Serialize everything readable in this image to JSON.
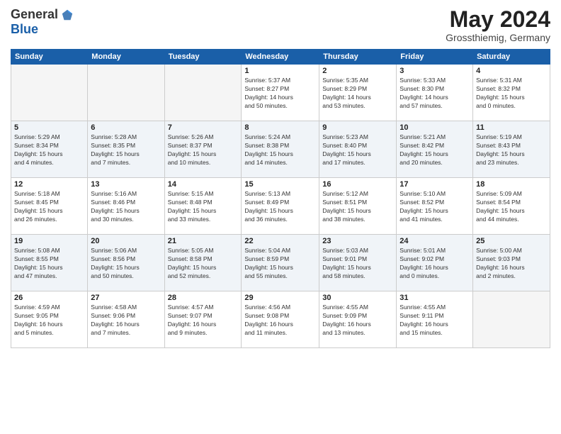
{
  "logo": {
    "general": "General",
    "blue": "Blue"
  },
  "title": "May 2024",
  "location": "Grossthiemig, Germany",
  "weekdays": [
    "Sunday",
    "Monday",
    "Tuesday",
    "Wednesday",
    "Thursday",
    "Friday",
    "Saturday"
  ],
  "weeks": [
    [
      {
        "day": "",
        "info": ""
      },
      {
        "day": "",
        "info": ""
      },
      {
        "day": "",
        "info": ""
      },
      {
        "day": "1",
        "info": "Sunrise: 5:37 AM\nSunset: 8:27 PM\nDaylight: 14 hours\nand 50 minutes."
      },
      {
        "day": "2",
        "info": "Sunrise: 5:35 AM\nSunset: 8:29 PM\nDaylight: 14 hours\nand 53 minutes."
      },
      {
        "day": "3",
        "info": "Sunrise: 5:33 AM\nSunset: 8:30 PM\nDaylight: 14 hours\nand 57 minutes."
      },
      {
        "day": "4",
        "info": "Sunrise: 5:31 AM\nSunset: 8:32 PM\nDaylight: 15 hours\nand 0 minutes."
      }
    ],
    [
      {
        "day": "5",
        "info": "Sunrise: 5:29 AM\nSunset: 8:34 PM\nDaylight: 15 hours\nand 4 minutes."
      },
      {
        "day": "6",
        "info": "Sunrise: 5:28 AM\nSunset: 8:35 PM\nDaylight: 15 hours\nand 7 minutes."
      },
      {
        "day": "7",
        "info": "Sunrise: 5:26 AM\nSunset: 8:37 PM\nDaylight: 15 hours\nand 10 minutes."
      },
      {
        "day": "8",
        "info": "Sunrise: 5:24 AM\nSunset: 8:38 PM\nDaylight: 15 hours\nand 14 minutes."
      },
      {
        "day": "9",
        "info": "Sunrise: 5:23 AM\nSunset: 8:40 PM\nDaylight: 15 hours\nand 17 minutes."
      },
      {
        "day": "10",
        "info": "Sunrise: 5:21 AM\nSunset: 8:42 PM\nDaylight: 15 hours\nand 20 minutes."
      },
      {
        "day": "11",
        "info": "Sunrise: 5:19 AM\nSunset: 8:43 PM\nDaylight: 15 hours\nand 23 minutes."
      }
    ],
    [
      {
        "day": "12",
        "info": "Sunrise: 5:18 AM\nSunset: 8:45 PM\nDaylight: 15 hours\nand 26 minutes."
      },
      {
        "day": "13",
        "info": "Sunrise: 5:16 AM\nSunset: 8:46 PM\nDaylight: 15 hours\nand 30 minutes."
      },
      {
        "day": "14",
        "info": "Sunrise: 5:15 AM\nSunset: 8:48 PM\nDaylight: 15 hours\nand 33 minutes."
      },
      {
        "day": "15",
        "info": "Sunrise: 5:13 AM\nSunset: 8:49 PM\nDaylight: 15 hours\nand 36 minutes."
      },
      {
        "day": "16",
        "info": "Sunrise: 5:12 AM\nSunset: 8:51 PM\nDaylight: 15 hours\nand 38 minutes."
      },
      {
        "day": "17",
        "info": "Sunrise: 5:10 AM\nSunset: 8:52 PM\nDaylight: 15 hours\nand 41 minutes."
      },
      {
        "day": "18",
        "info": "Sunrise: 5:09 AM\nSunset: 8:54 PM\nDaylight: 15 hours\nand 44 minutes."
      }
    ],
    [
      {
        "day": "19",
        "info": "Sunrise: 5:08 AM\nSunset: 8:55 PM\nDaylight: 15 hours\nand 47 minutes."
      },
      {
        "day": "20",
        "info": "Sunrise: 5:06 AM\nSunset: 8:56 PM\nDaylight: 15 hours\nand 50 minutes."
      },
      {
        "day": "21",
        "info": "Sunrise: 5:05 AM\nSunset: 8:58 PM\nDaylight: 15 hours\nand 52 minutes."
      },
      {
        "day": "22",
        "info": "Sunrise: 5:04 AM\nSunset: 8:59 PM\nDaylight: 15 hours\nand 55 minutes."
      },
      {
        "day": "23",
        "info": "Sunrise: 5:03 AM\nSunset: 9:01 PM\nDaylight: 15 hours\nand 58 minutes."
      },
      {
        "day": "24",
        "info": "Sunrise: 5:01 AM\nSunset: 9:02 PM\nDaylight: 16 hours\nand 0 minutes."
      },
      {
        "day": "25",
        "info": "Sunrise: 5:00 AM\nSunset: 9:03 PM\nDaylight: 16 hours\nand 2 minutes."
      }
    ],
    [
      {
        "day": "26",
        "info": "Sunrise: 4:59 AM\nSunset: 9:05 PM\nDaylight: 16 hours\nand 5 minutes."
      },
      {
        "day": "27",
        "info": "Sunrise: 4:58 AM\nSunset: 9:06 PM\nDaylight: 16 hours\nand 7 minutes."
      },
      {
        "day": "28",
        "info": "Sunrise: 4:57 AM\nSunset: 9:07 PM\nDaylight: 16 hours\nand 9 minutes."
      },
      {
        "day": "29",
        "info": "Sunrise: 4:56 AM\nSunset: 9:08 PM\nDaylight: 16 hours\nand 11 minutes."
      },
      {
        "day": "30",
        "info": "Sunrise: 4:55 AM\nSunset: 9:09 PM\nDaylight: 16 hours\nand 13 minutes."
      },
      {
        "day": "31",
        "info": "Sunrise: 4:55 AM\nSunset: 9:11 PM\nDaylight: 16 hours\nand 15 minutes."
      },
      {
        "day": "",
        "info": ""
      }
    ]
  ]
}
